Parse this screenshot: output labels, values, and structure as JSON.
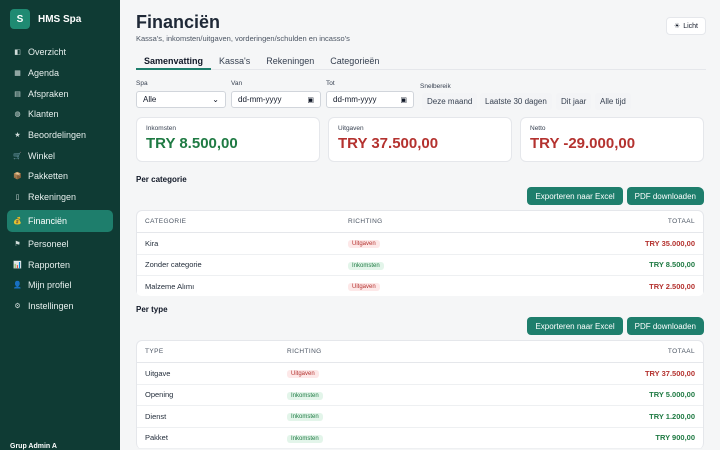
{
  "brand": {
    "logo_letter": "S",
    "name": "HMS Spa"
  },
  "sidebar": {
    "items": [
      {
        "icon": "overview-icon",
        "glyph": "◧",
        "label": "Overzicht",
        "active": false
      },
      {
        "icon": "calendar-icon",
        "glyph": "▦",
        "label": "Agenda",
        "active": false
      },
      {
        "icon": "appointments-icon",
        "glyph": "▤",
        "label": "Afspraken",
        "active": false
      },
      {
        "icon": "clients-icon",
        "glyph": "◍",
        "label": "Klanten",
        "active": false
      },
      {
        "icon": "star-icon",
        "glyph": "★",
        "label": "Beoordelingen",
        "active": false
      },
      {
        "icon": "cart-icon",
        "glyph": "🛒",
        "label": "Winkel",
        "active": false
      },
      {
        "icon": "package-icon",
        "glyph": "📦",
        "label": "Pakketten",
        "active": false
      },
      {
        "icon": "invoice-icon",
        "glyph": "▯",
        "label": "Rekeningen",
        "active": false
      },
      {
        "icon": "money-bag-icon",
        "glyph": "💰",
        "label": "Financiën",
        "active": true
      },
      {
        "icon": "staff-icon",
        "glyph": "⚑",
        "label": "Personeel",
        "active": false
      },
      {
        "icon": "report-icon",
        "glyph": "📊",
        "label": "Rapporten",
        "active": false
      },
      {
        "icon": "user-icon",
        "glyph": "👤",
        "label": "Mijn profiel",
        "active": false
      },
      {
        "icon": "gear-icon",
        "glyph": "⚙",
        "label": "Instellingen",
        "active": false
      }
    ],
    "footer": "Grup Admin A"
  },
  "header": {
    "title": "Financiën",
    "subtitle": "Kassa's, inkomsten/uitgaven, vorderingen/schulden en incasso's",
    "theme_button": "Licht",
    "theme_glyph": "☀"
  },
  "tabs": [
    {
      "label": "Samenvatting",
      "active": true
    },
    {
      "label": "Kassa's",
      "active": false
    },
    {
      "label": "Rekeningen",
      "active": false
    },
    {
      "label": "Categorieën",
      "active": false
    }
  ],
  "filters": {
    "spa_label": "Spa",
    "spa_value": "Alle",
    "from_label": "Van",
    "from_value": "dd-mm-yyyy",
    "to_label": "Tot",
    "to_value": "dd-mm-yyyy",
    "quick_label": "Snelbereik",
    "quick": [
      "Deze maand",
      "Laatste 30 dagen",
      "Dit jaar",
      "Alle tijd"
    ]
  },
  "kpis": {
    "income": {
      "label": "Inkomsten",
      "value": "TRY 8.500,00"
    },
    "expense": {
      "label": "Uitgaven",
      "value": "TRY 37.500,00"
    },
    "net": {
      "label": "Netto",
      "value": "TRY -29.000,00"
    }
  },
  "export_excel": "Exporteren naar Excel",
  "export_pdf": "PDF downloaden",
  "per_category": {
    "title": "Per categorie",
    "columns": [
      "CATEGORIE",
      "RICHTING",
      "TOTAAL"
    ],
    "rows": [
      {
        "name": "Kira",
        "direction": "Uitgaven",
        "kind": "out",
        "total": "TRY 35.000,00"
      },
      {
        "name": "Zonder categorie",
        "direction": "Inkomsten",
        "kind": "in",
        "total": "TRY 8.500,00"
      },
      {
        "name": "Malzeme Alımı",
        "direction": "Uitgaven",
        "kind": "out",
        "total": "TRY 2.500,00"
      }
    ]
  },
  "per_type": {
    "title": "Per type",
    "columns": [
      "TYPE",
      "RICHTING",
      "TOTAAL"
    ],
    "rows": [
      {
        "name": "Uitgave",
        "direction": "Uitgaven",
        "kind": "out",
        "total": "TRY 37.500,00"
      },
      {
        "name": "Opening",
        "direction": "Inkomsten",
        "kind": "in",
        "total": "TRY 5.000,00"
      },
      {
        "name": "Dienst",
        "direction": "Inkomsten",
        "kind": "in",
        "total": "TRY 1.200,00"
      },
      {
        "name": "Pakket",
        "direction": "Inkomsten",
        "kind": "in",
        "total": "TRY 900,00"
      }
    ]
  }
}
